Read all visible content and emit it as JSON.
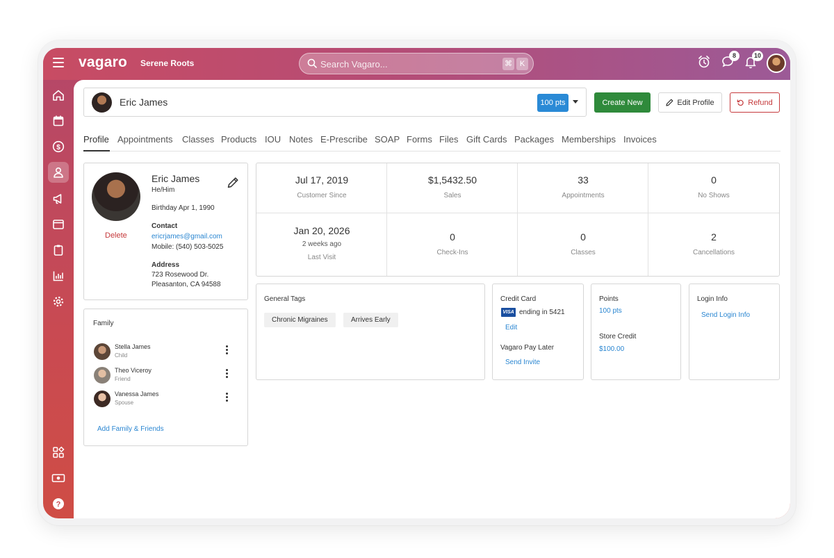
{
  "app": {
    "logo": "vagaro",
    "business_name": "Serene Roots",
    "search_placeholder": "Search Vagaro...",
    "shortcut_keys": [
      "⌘",
      "K"
    ],
    "notifications": {
      "messages_count": "8",
      "alerts_count": "10"
    },
    "colors": {
      "brand_gradient_start": "#c84c63",
      "brand_gradient_end": "#9c5a97",
      "primary_blue": "#2a8ad6",
      "create_green": "#2f8a3b",
      "refund_red": "#c5393b"
    }
  },
  "sidebar": {
    "items": [
      {
        "icon": "home-icon"
      },
      {
        "icon": "calendar-icon"
      },
      {
        "icon": "dollar-icon"
      },
      {
        "icon": "customer-icon",
        "active": true
      },
      {
        "icon": "megaphone-icon"
      },
      {
        "icon": "browser-icon"
      },
      {
        "icon": "clipboard-icon"
      },
      {
        "icon": "reports-icon"
      },
      {
        "icon": "settings-icon"
      },
      {
        "icon": "apps-icon"
      },
      {
        "icon": "cash-icon"
      },
      {
        "icon": "help-icon"
      }
    ]
  },
  "header": {
    "customer_name": "Eric James",
    "points_badge": "100 pts",
    "create_new": "Create New",
    "edit_profile": "Edit Profile",
    "refund": "Refund"
  },
  "tabs": [
    "Profile",
    "Appointments",
    "Classes",
    "Products",
    "IOU",
    "Notes",
    "E-Prescribe",
    "SOAP",
    "Forms",
    "Files",
    "Gift Cards",
    "Packages",
    "Memberships",
    "Invoices"
  ],
  "profile": {
    "name": "Eric James",
    "pronouns": "He/Him",
    "birthday": "Birthday Apr 1, 1990",
    "delete": "Delete",
    "contact_label": "Contact",
    "email": "ericrjames@gmail.com",
    "mobile": "Mobile: (540) 503-5025",
    "address_label": "Address",
    "address_line1": "723 Rosewood Dr.",
    "address_line2": "Pleasanton, CA 94588"
  },
  "family": {
    "title": "Family",
    "members": [
      {
        "name": "Stella James",
        "relation": "Child"
      },
      {
        "name": "Theo Viceroy",
        "relation": "Friend"
      },
      {
        "name": "Vanessa James",
        "relation": "Spouse"
      }
    ],
    "add_link": "Add Family & Friends"
  },
  "stats": {
    "row1": [
      {
        "value": "Jul 17, 2019",
        "label": "Customer Since"
      },
      {
        "value": "$1,5432.50",
        "label": "Sales"
      },
      {
        "value": "33",
        "label": "Appointments"
      },
      {
        "value": "0",
        "label": "No Shows"
      }
    ],
    "row2": [
      {
        "value": "Jan 20, 2026",
        "sub": "2 weeks ago",
        "label": "Last Visit"
      },
      {
        "value": "0",
        "label": "Check-Ins"
      },
      {
        "value": "0",
        "label": "Classes"
      },
      {
        "value": "2",
        "label": "Cancellations"
      }
    ]
  },
  "tags": {
    "title": "General Tags",
    "items": [
      "Chronic Migraines",
      "Arrives Early"
    ]
  },
  "credit_card": {
    "title": "Credit Card",
    "brand": "VISA",
    "ending": "ending in 5421",
    "edit": "Edit",
    "pay_later_title": "Vagaro Pay Later",
    "send_invite": "Send Invite"
  },
  "points": {
    "title": "Points",
    "value": "100 pts",
    "store_credit_title": "Store Credit",
    "store_credit_value": "$100.00"
  },
  "login": {
    "title": "Login Info",
    "send_link": "Send Login Info"
  }
}
